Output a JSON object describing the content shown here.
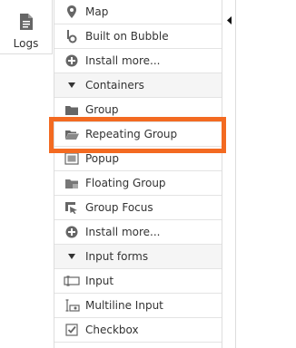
{
  "logs_tab": {
    "label": "Logs",
    "icon": "document-icon"
  },
  "elements": [
    {
      "label": "Map",
      "icon": "map-pin-icon",
      "kind": "item"
    },
    {
      "label": "Built on Bubble",
      "icon": "bubble-logo-icon",
      "kind": "item"
    },
    {
      "label": "Install more...",
      "icon": "plus-circle-icon",
      "kind": "item"
    },
    {
      "label": "Containers",
      "icon": "caret-down-icon",
      "kind": "section"
    },
    {
      "label": "Group",
      "icon": "folder-icon",
      "kind": "item"
    },
    {
      "label": "Repeating Group",
      "icon": "open-folder-icon",
      "kind": "item"
    },
    {
      "label": "Popup",
      "icon": "popup-icon",
      "kind": "item"
    },
    {
      "label": "Floating Group",
      "icon": "floating-folder-icon",
      "kind": "item"
    },
    {
      "label": "Group Focus",
      "icon": "group-focus-icon",
      "kind": "item"
    },
    {
      "label": "Install more...",
      "icon": "plus-circle-icon",
      "kind": "item"
    },
    {
      "label": "Input forms",
      "icon": "caret-down-icon",
      "kind": "section"
    },
    {
      "label": "Input",
      "icon": "input-icon",
      "kind": "item"
    },
    {
      "label": "Multiline Input",
      "icon": "multiline-input-icon",
      "kind": "item"
    },
    {
      "label": "Checkbox",
      "icon": "checkbox-icon",
      "kind": "item"
    }
  ],
  "highlight_color": "#f36a21"
}
